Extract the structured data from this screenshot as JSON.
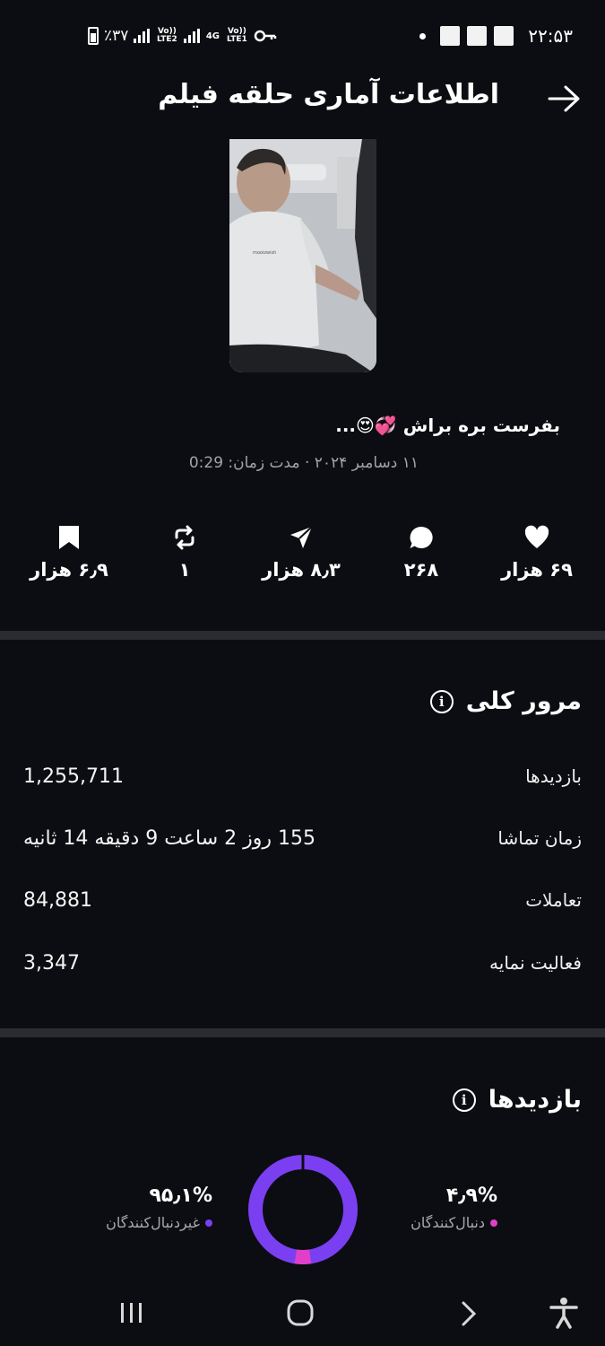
{
  "status_bar": {
    "time": "۲۲:۵۳",
    "battery": "٪۳۷",
    "net1": "Vo)) LTE2",
    "net2": "4G",
    "net3": "Vo)) LTE1"
  },
  "header": {
    "title": "اطلاعات آماری حلقه فیلم"
  },
  "post": {
    "caption": "بفرست بره براش 💞😍...",
    "meta": "۱۱ دسامبر ۲۰۲۴ · مدت زمان: 0:29",
    "thumb_shirt_text": "mooizwish"
  },
  "stats": {
    "likes": "۶۹ هزار",
    "comments": "۲۶۸",
    "shares": "۸٫۳ هزار",
    "reposts": "۱",
    "saves": "۶٫۹ هزار"
  },
  "overview": {
    "title": "مرور کلی",
    "rows": [
      {
        "label": "بازدیدها",
        "value": "1,255,711"
      },
      {
        "label": "زمان تماشا",
        "value": "155 روز 2 ساعت 9 دقیقه 14 ثانیه"
      },
      {
        "label": "تعاملات",
        "value": "84,881"
      },
      {
        "label": "فعالیت نمایه",
        "value": "3,347"
      }
    ]
  },
  "views": {
    "title": "بازدیدها",
    "followers_pct": "۴٫۹%",
    "followers_label": "دنبال‌کنندگان",
    "non_followers_pct": "۹۵٫۱%",
    "non_followers_label": "غیردنبال‌کنندگان",
    "followers_fraction": 0.049,
    "colors": {
      "followers": "#e040c8",
      "non_followers": "#7b3ff2"
    }
  }
}
